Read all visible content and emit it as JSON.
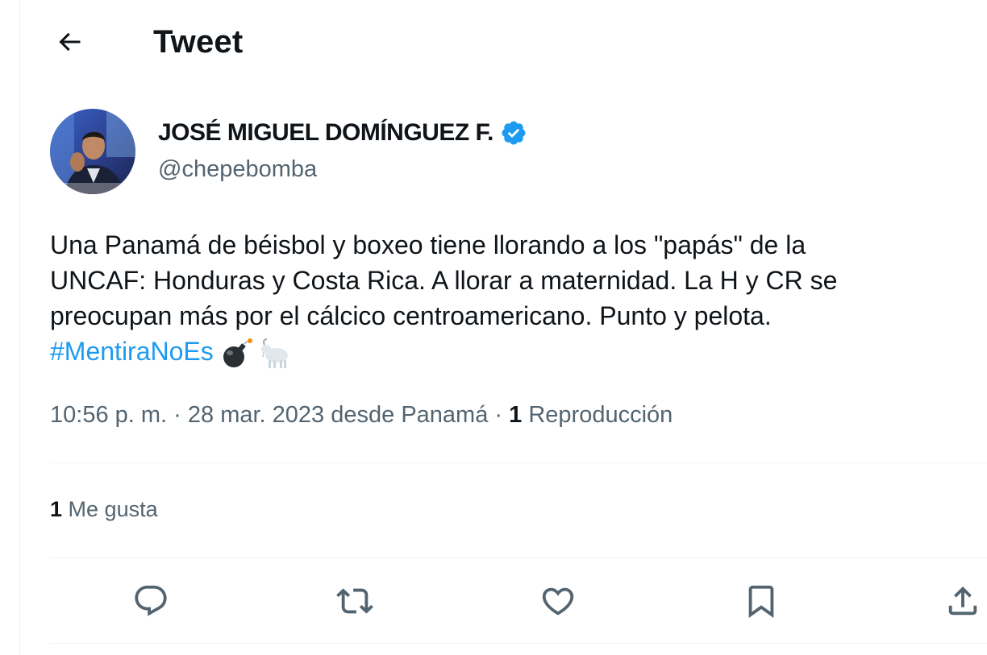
{
  "header": {
    "title": "Tweet",
    "back_icon": "arrow-left-icon"
  },
  "author": {
    "name": "JOSÉ MIGUEL DOMÍNGUEZ F.",
    "handle": "@chepebomba",
    "verified_icon": "verified-badge-icon",
    "verified_color": "#1d9bf0"
  },
  "tweet": {
    "text_lines": [
      "Una Panamá de béisbol y boxeo tiene llorando a los \"papás\" de la",
      "UNCAF: Honduras y Costa Rica. A llorar a maternidad. La H y CR se",
      "preocupan más por el cálcico centroamericano. Punto y pelota."
    ],
    "hashtag": "#MentiraNoEs",
    "emojis": [
      "bomb-emoji",
      "goat-emoji"
    ]
  },
  "meta": {
    "time": "10:56 p. m.",
    "separator": "·",
    "date": "28 mar. 2023",
    "location": "desde Panamá",
    "views_count": "1",
    "views_label": "Reproducción"
  },
  "stats": {
    "likes_count": "1",
    "likes_label": "Me gusta"
  },
  "actions": [
    {
      "name": "reply",
      "icon": "reply-icon"
    },
    {
      "name": "retweet",
      "icon": "retweet-icon"
    },
    {
      "name": "like",
      "icon": "heart-icon"
    },
    {
      "name": "bookmark",
      "icon": "bookmark-icon"
    },
    {
      "name": "share",
      "icon": "share-icon"
    }
  ],
  "colors": {
    "text_primary": "#0f1419",
    "text_secondary": "#536471",
    "accent": "#1d9bf0",
    "border": "#eff3f4"
  }
}
